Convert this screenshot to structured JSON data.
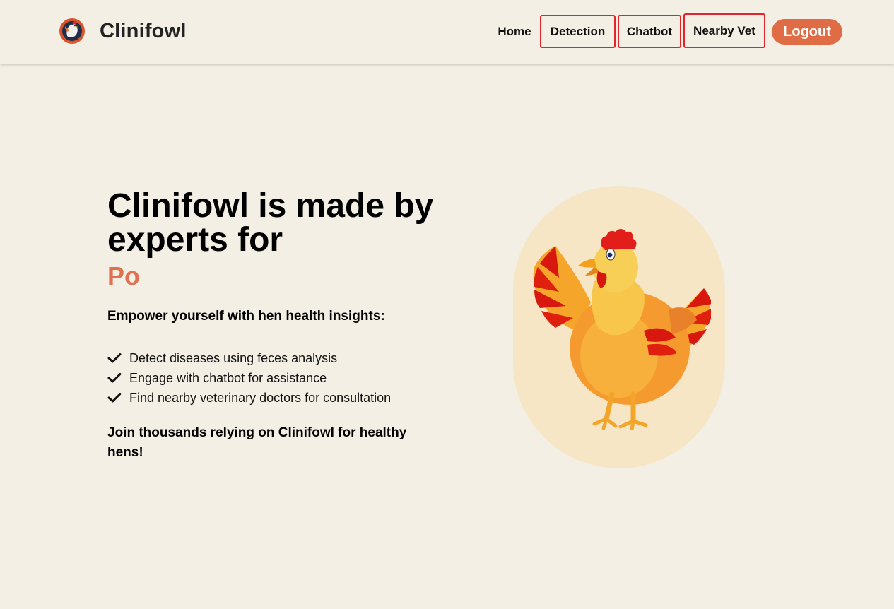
{
  "header": {
    "brand_name": "Clinifowl",
    "logo_icon": "rooster-logo-icon",
    "nav": {
      "home": "Home",
      "detection": "Detection",
      "chatbot": "Chatbot",
      "nearby_vet": "Nearby Vet"
    },
    "logout_label": "Logout"
  },
  "hero": {
    "title": "Clinifowl is made by experts for",
    "accent_text": "Po",
    "intro": "Empower yourself with hen health insights:",
    "features": [
      "Detect diseases using feces analysis",
      "Engage with chatbot for assistance",
      "Find nearby veterinary doctors for consultation"
    ],
    "feature_icon": "check-icon",
    "closing": "Join thousands relying on Clinifowl for healthy hens!",
    "illustration": "hen-illustration-icon"
  },
  "colors": {
    "background": "#f4efe4",
    "accent": "#e06c45",
    "highlight_border": "#e0262b",
    "illustration_bg": "#f6e6c6"
  }
}
